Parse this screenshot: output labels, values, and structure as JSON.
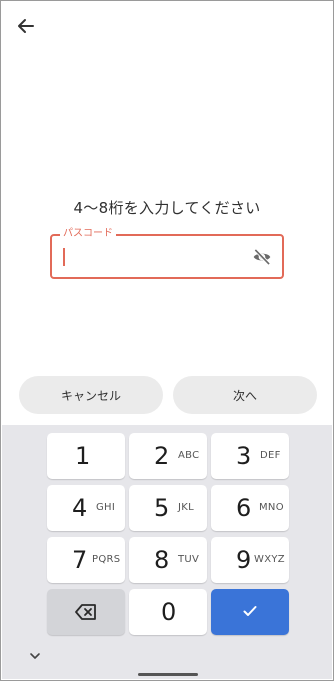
{
  "header": {
    "back_icon": "arrow-left-icon"
  },
  "prompt": "4〜8桁を入力してください",
  "passcode_field": {
    "label": "パスコード",
    "value": "",
    "visibility_icon": "eye-off-icon"
  },
  "buttons": {
    "cancel": "キャンセル",
    "next": "次へ"
  },
  "keypad": {
    "keys": [
      {
        "num": "1",
        "letters": ""
      },
      {
        "num": "2",
        "letters": "ABC"
      },
      {
        "num": "3",
        "letters": "DEF"
      },
      {
        "num": "4",
        "letters": "GHI"
      },
      {
        "num": "5",
        "letters": "JKL"
      },
      {
        "num": "6",
        "letters": "MNO"
      },
      {
        "num": "7",
        "letters": "PQRS"
      },
      {
        "num": "8",
        "letters": "TUV"
      },
      {
        "num": "9",
        "letters": "WXYZ"
      },
      {
        "num": "0",
        "letters": ""
      }
    ],
    "backspace_icon": "backspace-icon",
    "done_icon": "checkmark-icon",
    "accent_color": "#3a74d8"
  },
  "colors": {
    "error_outline": "#e26a58"
  }
}
